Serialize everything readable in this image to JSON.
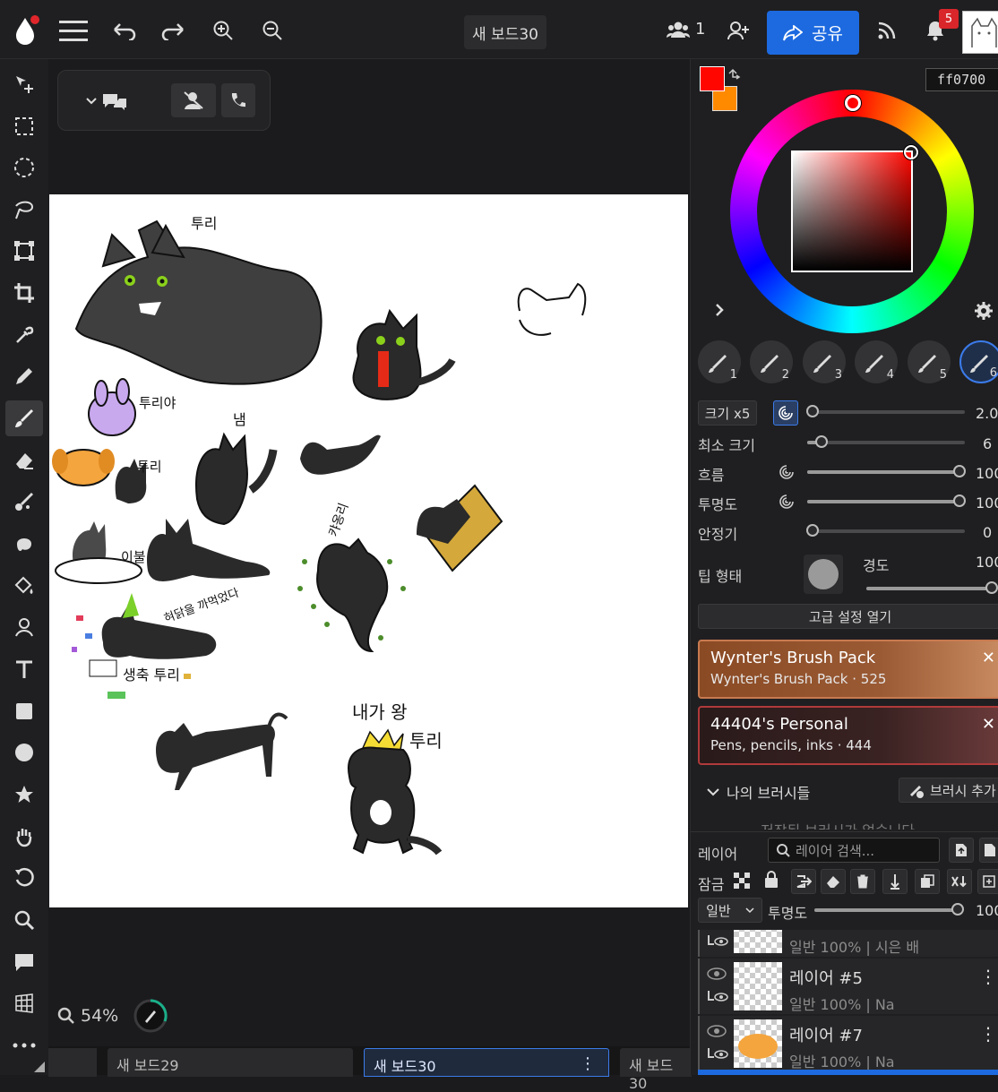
{
  "topbar": {
    "board_title": "새 보드30",
    "participants_count": "1",
    "share_label": "공유",
    "notification_count": "5"
  },
  "color": {
    "primary": "#ff0700",
    "secondary": "#ff8a00",
    "hex_value": "ff0700"
  },
  "brush_presets": [
    "1",
    "2",
    "3",
    "4",
    "5",
    "6"
  ],
  "brush_settings": {
    "size_button": "크기 x5",
    "size_value": "2.0",
    "min_size_label": "최소 크기",
    "min_size_value": "6",
    "flow_label": "흐름",
    "flow_value": "100",
    "opacity_label": "투명도",
    "opacity_value": "100",
    "stabilizer_label": "안정기",
    "stabilizer_value": "0",
    "tip_label": "팁 형태",
    "hardness_label": "경도",
    "hardness_value": "100",
    "advanced_button": "고급 설정 열기"
  },
  "brush_packs": [
    {
      "title": "Wynter's Brush Pack",
      "subtitle": "Wynter's Brush Pack · 525"
    },
    {
      "title": "44404's Personal",
      "subtitle": "Pens, pencils, inks · 444"
    }
  ],
  "my_brushes": {
    "label": "나의 브러시들",
    "add_label": "브러시 추가",
    "empty_text": "저장된 브러시가 없습니다"
  },
  "layers": {
    "title": "레이어",
    "search_placeholder": "레이어 검색...",
    "lock_label": "잠금",
    "blend_mode": "일반",
    "opacity_label": "투명도",
    "opacity_value": "100",
    "items": [
      {
        "name": "",
        "meta": "일반 100% | 시은 배"
      },
      {
        "name": "레이어 #5",
        "meta": "일반 100% | Na"
      },
      {
        "name": "레이어 #7",
        "meta": "일반 100% | Na"
      }
    ]
  },
  "canvas_labels": {
    "t1": "투리",
    "t2": "투리야",
    "t3": "투리",
    "t4": "냄",
    "t5": "이불",
    "t6": "캬옹리",
    "t7": "혀닭을 까먹었다",
    "t8": "생축 투리",
    "t9": "내가 왕",
    "t10": "투리"
  },
  "status": {
    "zoom": "54%"
  },
  "tabs": [
    {
      "label": "새 보드29"
    },
    {
      "label": "새 보드30"
    },
    {
      "label": "새 보드30"
    }
  ]
}
